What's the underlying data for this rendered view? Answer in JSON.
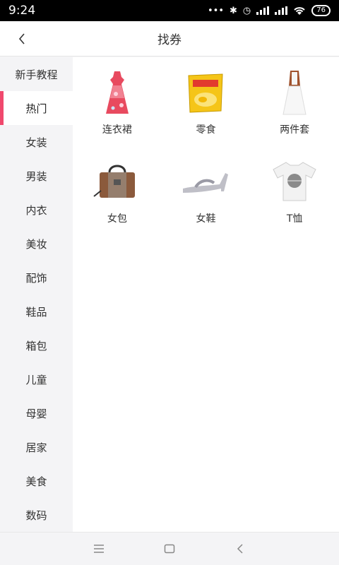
{
  "status": {
    "time": "9:24",
    "battery": "76"
  },
  "header": {
    "title": "找券"
  },
  "sidebar": {
    "items": [
      {
        "label": "新手教程"
      },
      {
        "label": "热门"
      },
      {
        "label": "女装"
      },
      {
        "label": "男装"
      },
      {
        "label": "内衣"
      },
      {
        "label": "美妆"
      },
      {
        "label": "配饰"
      },
      {
        "label": "鞋品"
      },
      {
        "label": "箱包"
      },
      {
        "label": "儿童"
      },
      {
        "label": "母婴"
      },
      {
        "label": "居家"
      },
      {
        "label": "美食"
      },
      {
        "label": "数码"
      }
    ]
  },
  "categories": [
    {
      "label": "连衣裙",
      "icon": "dress-icon"
    },
    {
      "label": "零食",
      "icon": "snack-bag-icon"
    },
    {
      "label": "两件套",
      "icon": "two-piece-outfit-icon"
    },
    {
      "label": "女包",
      "icon": "handbag-icon"
    },
    {
      "label": "女鞋",
      "icon": "sandal-icon"
    },
    {
      "label": "T恤",
      "icon": "tshirt-icon"
    }
  ],
  "colors": {
    "accent": "#f0486d"
  }
}
